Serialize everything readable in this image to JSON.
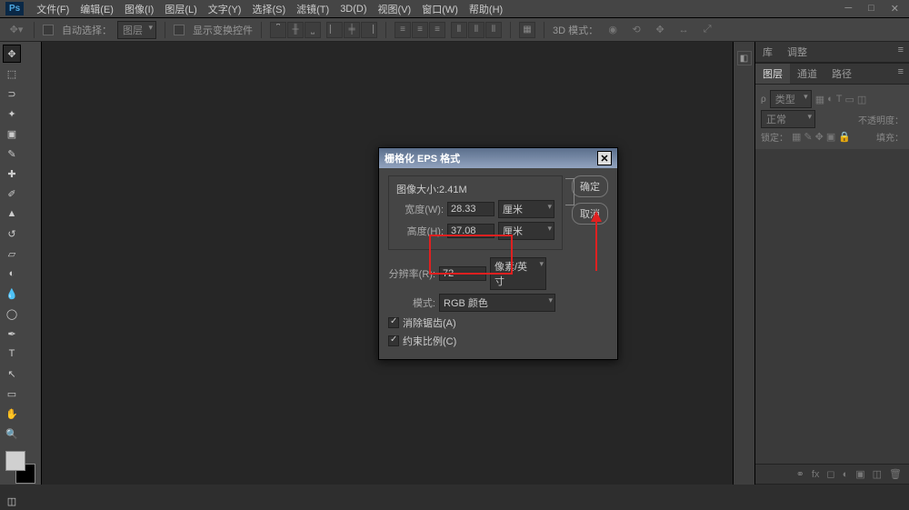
{
  "app": {
    "name": "Ps"
  },
  "menu": [
    "文件(F)",
    "编辑(E)",
    "图像(I)",
    "图层(L)",
    "文字(Y)",
    "选择(S)",
    "滤镜(T)",
    "3D(D)",
    "视图(V)",
    "窗口(W)",
    "帮助(H)"
  ],
  "options": {
    "auto_select_label": "自动选择：",
    "auto_select_value": "图层",
    "show_transform": "显示变换控件",
    "mode3d": "3D 模式："
  },
  "panels": {
    "group1": {
      "tabs": [
        "库",
        "调整"
      ]
    },
    "group2": {
      "tabs": [
        "图层",
        "通道",
        "路径"
      ],
      "kind_label": "类型",
      "blend": "正常",
      "opacity_label": "不透明度：",
      "lock_label": "锁定：",
      "fill_label": "填充："
    }
  },
  "dialog": {
    "title": "栅格化 EPS 格式",
    "ok": "确定",
    "cancel": "取消",
    "image_size_label": "图像大小:2.41M",
    "width_label": "宽度(W):",
    "width_value": "28.33",
    "width_unit": "厘米",
    "height_label": "高度(H):",
    "height_value": "37.08",
    "height_unit": "厘米",
    "res_label": "分辨率(R):",
    "res_value": "72",
    "res_unit": "像素/英寸",
    "mode_label": "模式:",
    "mode_value": "RGB 颜色",
    "antialias": "消除锯齿(A)",
    "constrain": "约束比例(C)"
  }
}
